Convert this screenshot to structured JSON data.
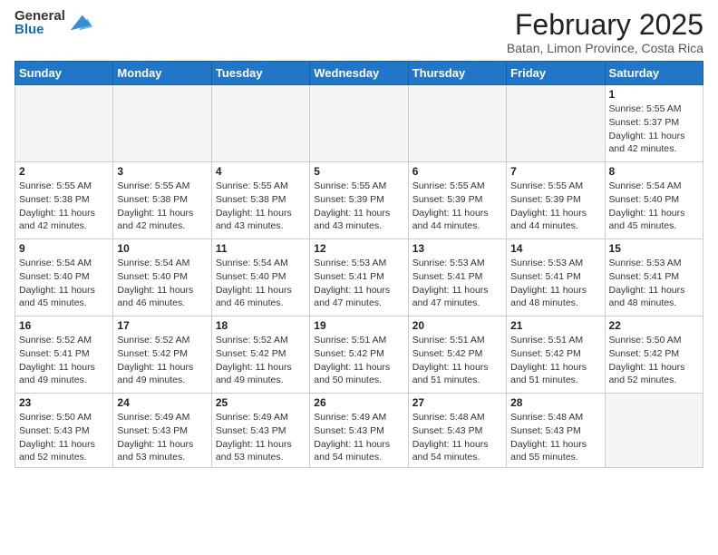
{
  "header": {
    "logo_general": "General",
    "logo_blue": "Blue",
    "month_title": "February 2025",
    "location": "Batan, Limon Province, Costa Rica"
  },
  "weekdays": [
    "Sunday",
    "Monday",
    "Tuesday",
    "Wednesday",
    "Thursday",
    "Friday",
    "Saturday"
  ],
  "weeks": [
    [
      {
        "day": "",
        "sunrise": "",
        "sunset": "",
        "daylight": ""
      },
      {
        "day": "",
        "sunrise": "",
        "sunset": "",
        "daylight": ""
      },
      {
        "day": "",
        "sunrise": "",
        "sunset": "",
        "daylight": ""
      },
      {
        "day": "",
        "sunrise": "",
        "sunset": "",
        "daylight": ""
      },
      {
        "day": "",
        "sunrise": "",
        "sunset": "",
        "daylight": ""
      },
      {
        "day": "",
        "sunrise": "",
        "sunset": "",
        "daylight": ""
      },
      {
        "day": "1",
        "sunrise": "5:55 AM",
        "sunset": "5:37 PM",
        "daylight": "11 hours and 42 minutes."
      }
    ],
    [
      {
        "day": "2",
        "sunrise": "5:55 AM",
        "sunset": "5:38 PM",
        "daylight": "11 hours and 42 minutes."
      },
      {
        "day": "3",
        "sunrise": "5:55 AM",
        "sunset": "5:38 PM",
        "daylight": "11 hours and 42 minutes."
      },
      {
        "day": "4",
        "sunrise": "5:55 AM",
        "sunset": "5:38 PM",
        "daylight": "11 hours and 43 minutes."
      },
      {
        "day": "5",
        "sunrise": "5:55 AM",
        "sunset": "5:39 PM",
        "daylight": "11 hours and 43 minutes."
      },
      {
        "day": "6",
        "sunrise": "5:55 AM",
        "sunset": "5:39 PM",
        "daylight": "11 hours and 44 minutes."
      },
      {
        "day": "7",
        "sunrise": "5:55 AM",
        "sunset": "5:39 PM",
        "daylight": "11 hours and 44 minutes."
      },
      {
        "day": "8",
        "sunrise": "5:54 AM",
        "sunset": "5:40 PM",
        "daylight": "11 hours and 45 minutes."
      }
    ],
    [
      {
        "day": "9",
        "sunrise": "5:54 AM",
        "sunset": "5:40 PM",
        "daylight": "11 hours and 45 minutes."
      },
      {
        "day": "10",
        "sunrise": "5:54 AM",
        "sunset": "5:40 PM",
        "daylight": "11 hours and 46 minutes."
      },
      {
        "day": "11",
        "sunrise": "5:54 AM",
        "sunset": "5:40 PM",
        "daylight": "11 hours and 46 minutes."
      },
      {
        "day": "12",
        "sunrise": "5:53 AM",
        "sunset": "5:41 PM",
        "daylight": "11 hours and 47 minutes."
      },
      {
        "day": "13",
        "sunrise": "5:53 AM",
        "sunset": "5:41 PM",
        "daylight": "11 hours and 47 minutes."
      },
      {
        "day": "14",
        "sunrise": "5:53 AM",
        "sunset": "5:41 PM",
        "daylight": "11 hours and 48 minutes."
      },
      {
        "day": "15",
        "sunrise": "5:53 AM",
        "sunset": "5:41 PM",
        "daylight": "11 hours and 48 minutes."
      }
    ],
    [
      {
        "day": "16",
        "sunrise": "5:52 AM",
        "sunset": "5:41 PM",
        "daylight": "11 hours and 49 minutes."
      },
      {
        "day": "17",
        "sunrise": "5:52 AM",
        "sunset": "5:42 PM",
        "daylight": "11 hours and 49 minutes."
      },
      {
        "day": "18",
        "sunrise": "5:52 AM",
        "sunset": "5:42 PM",
        "daylight": "11 hours and 49 minutes."
      },
      {
        "day": "19",
        "sunrise": "5:51 AM",
        "sunset": "5:42 PM",
        "daylight": "11 hours and 50 minutes."
      },
      {
        "day": "20",
        "sunrise": "5:51 AM",
        "sunset": "5:42 PM",
        "daylight": "11 hours and 51 minutes."
      },
      {
        "day": "21",
        "sunrise": "5:51 AM",
        "sunset": "5:42 PM",
        "daylight": "11 hours and 51 minutes."
      },
      {
        "day": "22",
        "sunrise": "5:50 AM",
        "sunset": "5:42 PM",
        "daylight": "11 hours and 52 minutes."
      }
    ],
    [
      {
        "day": "23",
        "sunrise": "5:50 AM",
        "sunset": "5:43 PM",
        "daylight": "11 hours and 52 minutes."
      },
      {
        "day": "24",
        "sunrise": "5:49 AM",
        "sunset": "5:43 PM",
        "daylight": "11 hours and 53 minutes."
      },
      {
        "day": "25",
        "sunrise": "5:49 AM",
        "sunset": "5:43 PM",
        "daylight": "11 hours and 53 minutes."
      },
      {
        "day": "26",
        "sunrise": "5:49 AM",
        "sunset": "5:43 PM",
        "daylight": "11 hours and 54 minutes."
      },
      {
        "day": "27",
        "sunrise": "5:48 AM",
        "sunset": "5:43 PM",
        "daylight": "11 hours and 54 minutes."
      },
      {
        "day": "28",
        "sunrise": "5:48 AM",
        "sunset": "5:43 PM",
        "daylight": "11 hours and 55 minutes."
      },
      {
        "day": "",
        "sunrise": "",
        "sunset": "",
        "daylight": ""
      }
    ]
  ]
}
